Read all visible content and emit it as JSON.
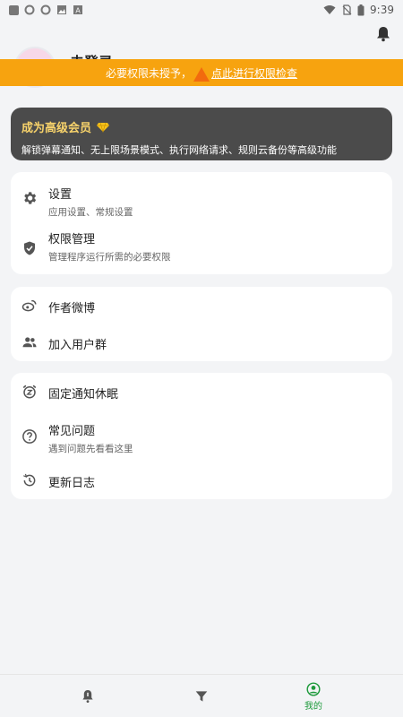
{
  "statusbar": {
    "time": "9:39"
  },
  "profile": {
    "name": "未登录"
  },
  "banner": {
    "text": "必要权限未授予，",
    "link": "点此进行权限检查"
  },
  "vip": {
    "title": "成为高级会员",
    "description": "解锁弹幕通知、无上限场景模式、执行网络请求、规则云备份等高级功能"
  },
  "menu_group1": [
    {
      "title": "设置",
      "subtitle": "应用设置、常规设置",
      "icon": "gear-icon"
    },
    {
      "title": "权限管理",
      "subtitle": "管理程序运行所需的必要权限",
      "icon": "shield-icon"
    }
  ],
  "menu_group2": [
    {
      "title": "作者微博",
      "icon": "weibo-icon"
    },
    {
      "title": "加入用户群",
      "icon": "group-icon"
    }
  ],
  "menu_group3": [
    {
      "title": "固定通知休眠",
      "icon": "alarm-snooze-icon"
    },
    {
      "title": "常见问题",
      "subtitle": "遇到问题先看看这里",
      "icon": "help-icon"
    },
    {
      "title": "更新日志",
      "icon": "history-icon"
    }
  ],
  "bottom_nav": [
    {
      "label": "",
      "icon": "bell-icon"
    },
    {
      "label": "",
      "icon": "filter-icon"
    },
    {
      "label": "我的",
      "icon": "person-icon"
    }
  ],
  "colors": {
    "accent": "#1e9a3c",
    "banner": "#f7a30f",
    "vip_bg": "#4b4b4b",
    "vip_title": "#f8d36b"
  }
}
